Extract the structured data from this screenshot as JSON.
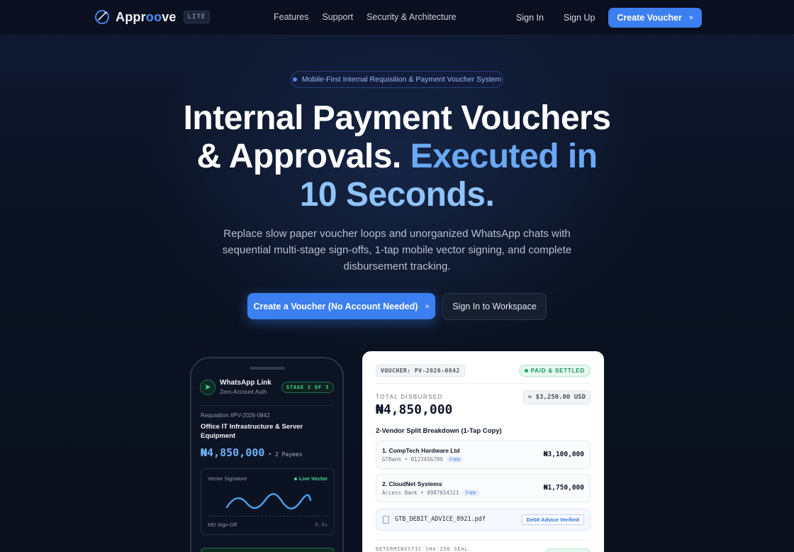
{
  "nav": {
    "brand_prefix": "Appr",
    "brand_oo": "oo",
    "brand_suffix": "ve",
    "brand_badge": "LITE",
    "links": [
      "Features",
      "Support",
      "Security & Architecture"
    ],
    "sign_in": "Sign In",
    "sign_up": "Sign Up",
    "cta": "Create Voucher"
  },
  "hero": {
    "pill": "Mobile-First Internal Requisition & Payment Voucher System",
    "title_line1": "Internal Payment Vouchers",
    "title_line2a": "& Approvals. ",
    "title_line2b": "Executed in",
    "title_line3": "10 Seconds.",
    "subtitle": "Replace slow paper voucher loops and unorganized WhatsApp chats with sequential multi-stage sign-offs, 1-tap mobile vector signing, and complete disbursement tracking.",
    "cta_primary": "Create a Voucher (No Account Needed)",
    "cta_secondary": "Sign In to Workspace"
  },
  "phone": {
    "title": "WhatsApp Link",
    "subtitle": "Zero-Account Auth",
    "stage": "STAGE 2 OF 3",
    "requisition": "Requisition #PV-2026-0842",
    "req_title": "Office IT Infrastructure & Server Equipment",
    "amount": "₦4,850,000",
    "payees": "• 2 Payees",
    "sig_label": "Vector Signature",
    "sig_status": "Live Vector",
    "sig_footer": "MD Sign-Off",
    "sig_time": "0.4s"
  },
  "card": {
    "voucher": "VOUCHER: PV-2026-0842",
    "status": "PAID & SETTLED",
    "total_label": "TOTAL DISBURSED",
    "total_value": "₦4,850,000",
    "usd": "≈ $3,250.00 USD",
    "split_heading": "2-Vendor Split Breakdown (1-Tap Copy)",
    "vendors": [
      {
        "name": "1. CompTech Hardware Ltd",
        "bank": "GTBank • 0123456789",
        "copy": "Copy",
        "amount": "₦3,100,000"
      },
      {
        "name": "2. CloudNet Systems",
        "bank": "Access Bank • 0987654321",
        "copy": "Copy",
        "amount": "₦1,750,000"
      }
    ],
    "file": "GTB_DEBIT_ADVICE_8921.pdf",
    "file_status": "Debit Advice Verified",
    "seal": "DETERMINISTIC SHA-256 SEAL"
  },
  "colors": {
    "accent": "#3b7ff0",
    "gradient_text": "#6aa9f5",
    "success": "#16a764",
    "background": "#0b1120"
  }
}
